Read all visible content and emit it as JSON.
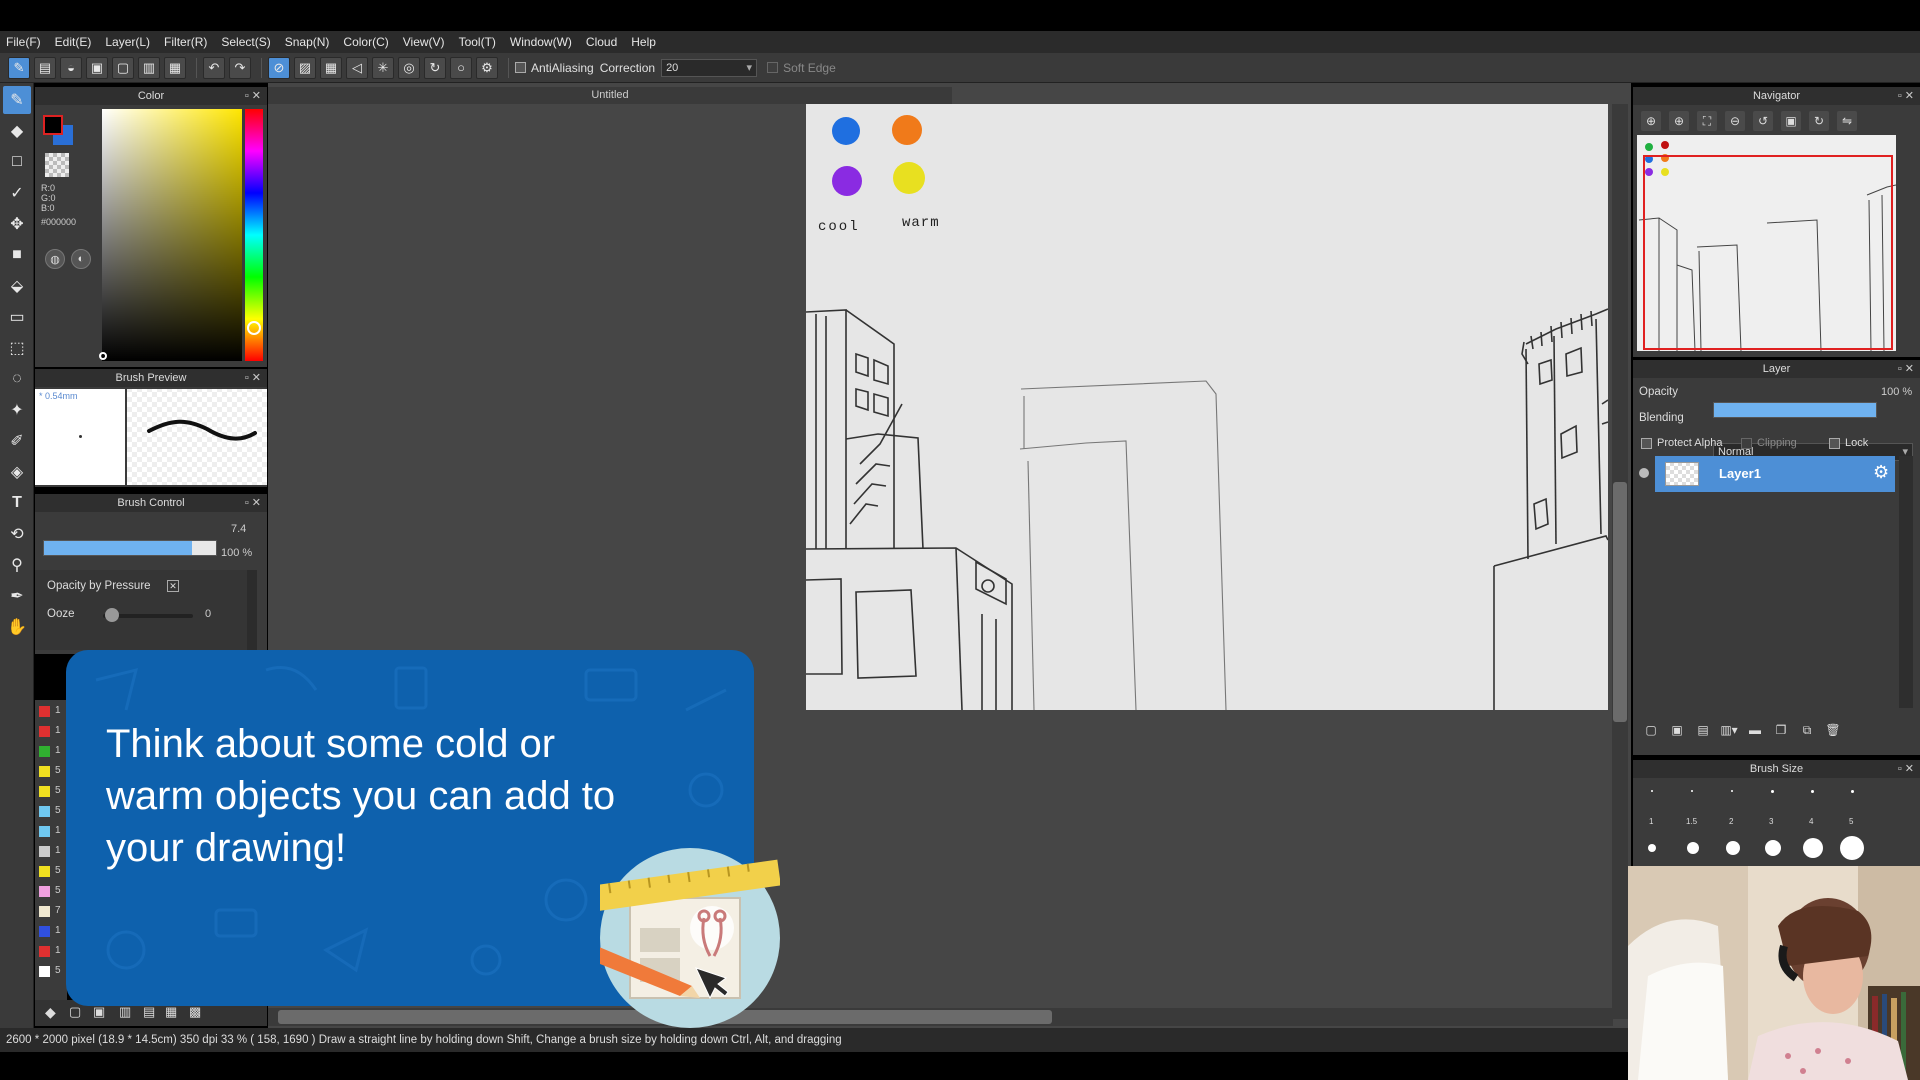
{
  "menu": [
    "File(F)",
    "Edit(E)",
    "Layer(L)",
    "Filter(R)",
    "Select(S)",
    "Snap(N)",
    "Color(C)",
    "View(V)",
    "Tool(T)",
    "Window(W)",
    "Cloud",
    "Help"
  ],
  "toolbar": {
    "antialias_label": "AntiAliasing",
    "correction_label": "Correction",
    "correction_value": "20",
    "softedge_label": "Soft Edge"
  },
  "color_panel": {
    "title": "Color",
    "rgb_readout": "R:0\nG:0\nB:0",
    "hex": "#000000",
    "foreground": "#000000",
    "background": "#2a6fd6"
  },
  "brush_preview": {
    "title": "Brush Preview",
    "size_label": "0.54mm"
  },
  "brush_control": {
    "title": "Brush Control",
    "size_value": "7.4",
    "size_fraction": 0.86,
    "opacity_value": "100 %",
    "opacity_fraction": 1.0,
    "opacity_by_pressure_label": "Opacity by Pressure",
    "ooze_label": "Ooze",
    "ooze_value": "0"
  },
  "document": {
    "tab_title": "Untitled"
  },
  "canvas_notes": {
    "cool_label": "cool",
    "warm_label": "warm"
  },
  "navigator": {
    "title": "Navigator"
  },
  "layer_panel": {
    "title": "Layer",
    "opacity_label": "Opacity",
    "opacity_value": "100 %",
    "opacity_fraction": 1.0,
    "blending_label": "Blending",
    "blending_value": "Normal",
    "protect_alpha_label": "Protect Alpha",
    "clipping_label": "Clipping",
    "lock_label": "Lock",
    "layers": [
      {
        "name": "Layer1",
        "selected": true
      }
    ]
  },
  "brush_size": {
    "title": "Brush Size",
    "sizes": [
      "1",
      "1.5",
      "2",
      "3",
      "4",
      "5"
    ]
  },
  "left_list": {
    "colors": [
      "#e03030",
      "#e03030",
      "#30b030",
      "#f0e020",
      "#f0e020",
      "#70c8f0",
      "#70c8f0",
      "#cccccc",
      "#f0e020",
      "#f0a0e0",
      "#f0e8d0",
      "#3050e0",
      "#e03030",
      "#ffffff"
    ],
    "numbers": [
      "1",
      "1",
      "1",
      "5",
      "5",
      "5",
      "1",
      "1",
      "5",
      "5",
      "7",
      "1",
      "1",
      "5"
    ]
  },
  "status": {
    "dimensions": "2600 * 2000 pixel",
    "physical_size": "(18.9 * 14.5cm)",
    "dpi": "350 dpi",
    "zoom": "33 %",
    "cursor": "( 158, 1690 )",
    "hint": "Draw a straight line by holding down Shift, Change a brush size by holding down Ctrl, Alt, and dragging"
  },
  "tip": {
    "text": "Think about some cold or warm objects you can add to your drawing!"
  },
  "swatch_colors": {
    "blue": "#1f6fe0",
    "orange": "#f07a1a",
    "purple": "#8a2be2",
    "yellow": "#e8e020"
  }
}
